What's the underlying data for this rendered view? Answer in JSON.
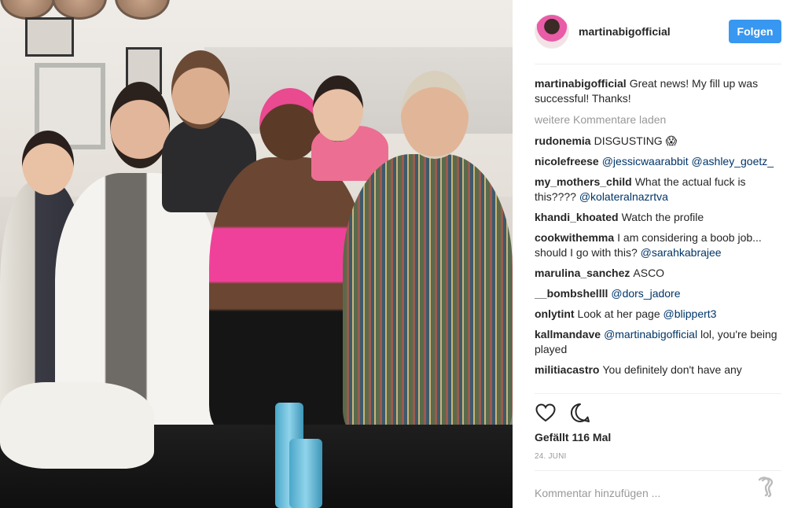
{
  "post": {
    "username": "martinabigofficial",
    "follow_label": "Folgen",
    "caption": {
      "user": "martinabigofficial",
      "text": "Great news! My fill up was successful! Thanks!"
    },
    "load_more_label": "weitere Kommentare laden",
    "comments": [
      {
        "user": "rudonemia",
        "parts": [
          {
            "t": "text",
            "v": "DISGUSTING 😱"
          }
        ]
      },
      {
        "user": "nicolefreese",
        "parts": [
          {
            "t": "mention",
            "v": "@jessicwaarabbit"
          },
          {
            "t": "text",
            "v": " "
          },
          {
            "t": "mention",
            "v": "@ashley_goetz_"
          }
        ]
      },
      {
        "user": "my_mothers_child",
        "parts": [
          {
            "t": "text",
            "v": "What the actual fuck is this???? "
          },
          {
            "t": "mention",
            "v": "@kolateralnazrtva"
          }
        ]
      },
      {
        "user": "khandi_khoated",
        "parts": [
          {
            "t": "text",
            "v": "Watch the profile"
          }
        ]
      },
      {
        "user": "cookwithemma",
        "parts": [
          {
            "t": "text",
            "v": "I am considering a boob job... should I go with this? "
          },
          {
            "t": "mention",
            "v": "@sarahkabrajee"
          }
        ]
      },
      {
        "user": "marulina_sanchez",
        "parts": [
          {
            "t": "text",
            "v": "ASCO"
          }
        ]
      },
      {
        "user": "__bombshellll",
        "parts": [
          {
            "t": "mention",
            "v": "@dors_jadore"
          }
        ]
      },
      {
        "user": "onlytint",
        "parts": [
          {
            "t": "text",
            "v": "Look at her page "
          },
          {
            "t": "mention",
            "v": "@blippert3"
          }
        ]
      },
      {
        "user": "kallmandave",
        "parts": [
          {
            "t": "mention",
            "v": "@martinabigofficial"
          },
          {
            "t": "text",
            "v": " lol, you're being played"
          }
        ]
      },
      {
        "user": "militiacastro",
        "parts": [
          {
            "t": "text",
            "v": "You definitely don't have any"
          }
        ]
      }
    ],
    "likes_label": "Gefällt 116 Mal",
    "date_label": "24. JUNI",
    "comment_placeholder": "Kommentar hinzufügen ...",
    "icons": {
      "like": "heart-icon",
      "comment": "comment-bubble-icon",
      "more": "more-options-icon"
    },
    "colors": {
      "accent": "#3897f0",
      "mention": "#003569",
      "muted": "#999999",
      "divider": "#efefef"
    }
  }
}
